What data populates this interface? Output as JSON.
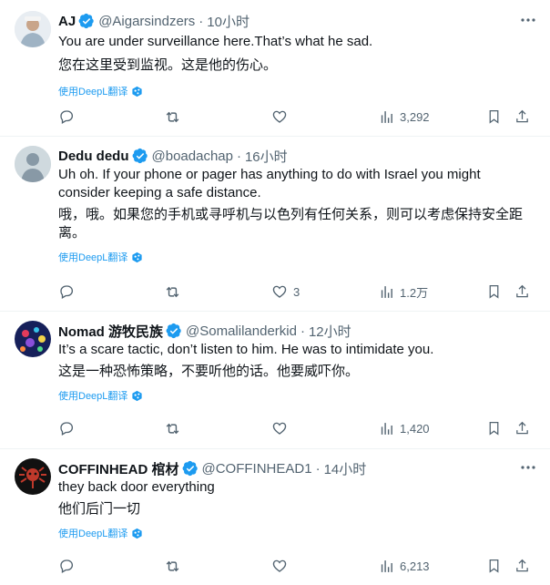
{
  "tweets": [
    {
      "name": "AJ",
      "handle": "@Aigarsindzers",
      "dot": "·",
      "time": "10小时",
      "text_en": "You are under surveillance here.That’s what he sad.",
      "text_zh": "您在这里受到监视。这是他的伤心。",
      "translate_label": "使用DeepL翻译",
      "likes": "",
      "views": "3,292",
      "avatar_color": "#8fa3b5"
    },
    {
      "name": "Dedu dedu",
      "handle": "@boadachap",
      "dot": "·",
      "time": "16小时",
      "text_en": "Uh oh. If your phone or pager has anything to do with Israel you might consider keeping a safe distance.",
      "text_zh": "哦，哦。如果您的手机或寻呼机与以色列有任何关系，则可以考虑保持安全距离。",
      "translate_label": "使用DeepL翻译",
      "likes": "3",
      "views": "1.2万",
      "avatar_color": "#cfd9de"
    },
    {
      "name": "Nomad 游牧民族",
      "handle": "@Somalilanderkid",
      "dot": "·",
      "time": "12小时",
      "text_en": "It’s a scare tactic, don’t listen to him. He was to intimidate you.",
      "text_zh": "这是一种恐怖策略，不要听他的话。他要威吓你。",
      "translate_label": "使用DeepL翻译",
      "likes": "",
      "views": "1,420",
      "avatar_color": "#1b2a6b"
    },
    {
      "name": "COFFINHEAD 棺材",
      "handle": "@COFFINHEAD1",
      "dot": "·",
      "time": "14小时",
      "text_en": "they back door everything",
      "text_zh": "他们后门一切",
      "translate_label": "使用DeepL翻译",
      "likes": "",
      "views": "6,213",
      "avatar_color": "#1a1a1a"
    }
  ],
  "colors": {
    "verified": "#1d9bf0",
    "link": "#1d9bf0",
    "muted": "#536471",
    "divider": "#eff3f4"
  },
  "icons": [
    "verified-badge-icon",
    "more-icon",
    "reply-icon",
    "retweet-icon",
    "like-icon",
    "views-icon",
    "bookmark-icon",
    "share-icon",
    "deepl-icon"
  ]
}
